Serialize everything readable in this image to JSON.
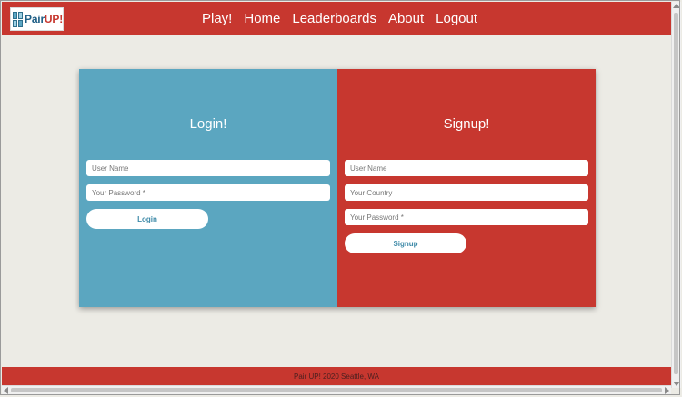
{
  "brand": {
    "text_primary": "Pair",
    "text_accent": "UP!",
    "logo_icon": "grid-icon"
  },
  "nav": {
    "items": [
      {
        "label": "Play!"
      },
      {
        "label": "Home"
      },
      {
        "label": "Leaderboards"
      },
      {
        "label": "About"
      },
      {
        "label": "Logout"
      }
    ]
  },
  "login": {
    "title": "Login!",
    "username_placeholder": "User Name",
    "password_placeholder": "Your Password *",
    "button_label": "Login"
  },
  "signup": {
    "title": "Signup!",
    "username_placeholder": "User Name",
    "country_placeholder": "Your Country",
    "password_placeholder": "Your Password *",
    "button_label": "Signup"
  },
  "footer": {
    "text": "Pair UP! 2020 Seattle, WA"
  },
  "colors": {
    "brand_red": "#c7372f",
    "login_blue": "#5ba6c0",
    "background": "#ecebe5"
  }
}
